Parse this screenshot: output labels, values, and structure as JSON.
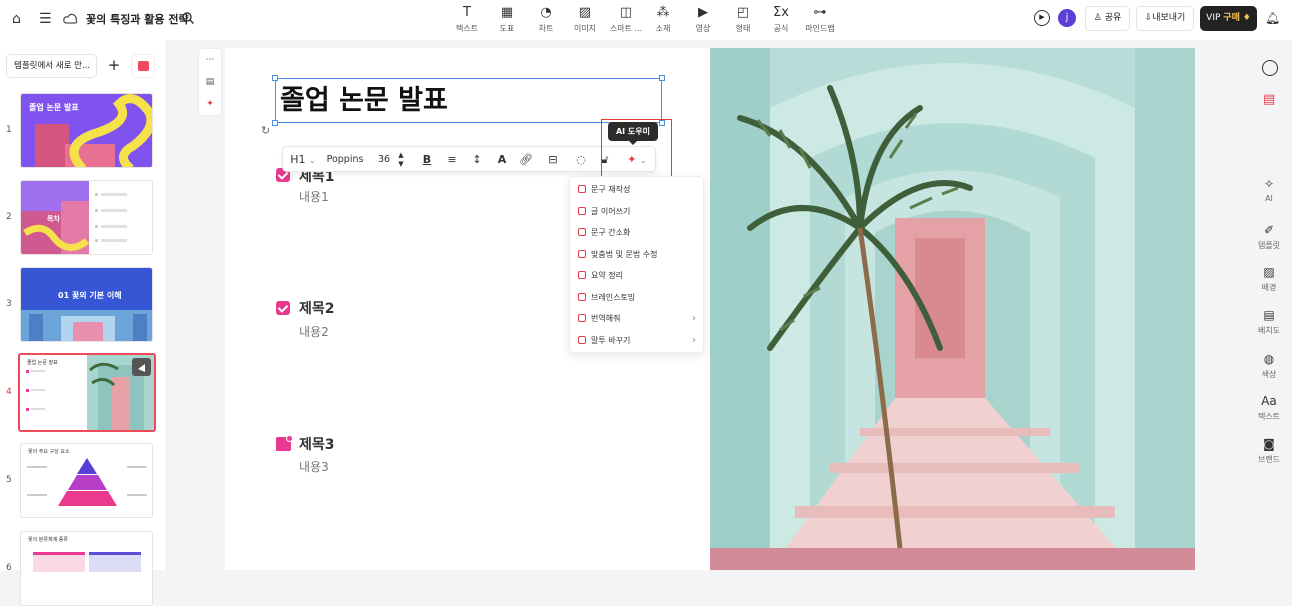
{
  "header": {
    "doc_title": "꽃의 특징과 활용 전략",
    "tools": [
      {
        "icon": "text-icon",
        "glyph": "T",
        "label": "텍스트"
      },
      {
        "icon": "table-icon",
        "glyph": "▦",
        "label": "도표"
      },
      {
        "icon": "chart-icon",
        "glyph": "◔",
        "label": "차트"
      },
      {
        "icon": "image-icon",
        "glyph": "▨",
        "label": "이미지"
      },
      {
        "icon": "smart-icon",
        "glyph": "◫",
        "label": "스마트 ..."
      },
      {
        "icon": "element-icon",
        "glyph": "⁂",
        "label": "소재"
      },
      {
        "icon": "video-icon",
        "glyph": "▶",
        "label": "영상"
      },
      {
        "icon": "shape-icon",
        "glyph": "◰",
        "label": "형태"
      },
      {
        "icon": "formula-icon",
        "glyph": "Σx",
        "label": "공식"
      },
      {
        "icon": "mindmap-icon",
        "glyph": "⊶",
        "label": "마인드맵"
      }
    ],
    "avatar_initial": "j",
    "share_label": "공유",
    "export_label": "내보내기",
    "vip_label": "VIP",
    "vip_buy": "구매"
  },
  "left_panel": {
    "template_button": "템플릿에서 새로 만...",
    "slides": [
      {
        "num": "1",
        "caption": "졸업 논문 발표"
      },
      {
        "num": "2",
        "caption": "목차"
      },
      {
        "num": "3",
        "caption": "01 꽃의 기본 이해"
      },
      {
        "num": "4",
        "caption": "졸업 논문 발표"
      },
      {
        "num": "5",
        "caption": "꽃의 주요 구성 요소"
      },
      {
        "num": "6",
        "caption": "꽃의 분류체계 종류"
      }
    ]
  },
  "slide": {
    "title": "졸업 논문 발표",
    "items": [
      {
        "title": "제목1",
        "body": "내용1"
      },
      {
        "title": "제목2",
        "body": "내용2"
      },
      {
        "title": "제목3",
        "body": "내용3"
      }
    ]
  },
  "format_toolbar": {
    "heading": "H1",
    "font": "Poppins",
    "size": "36"
  },
  "ai_tooltip": "AI 도우미",
  "ai_menu": [
    {
      "label": "문구 재작성",
      "submenu": false
    },
    {
      "label": "글 이어쓰기",
      "submenu": false
    },
    {
      "label": "문구 간소화",
      "submenu": false
    },
    {
      "label": "맞춤법 및 문법 수정",
      "submenu": false
    },
    {
      "label": "요약 정리",
      "submenu": false
    },
    {
      "label": "브레인스토밍",
      "submenu": false
    },
    {
      "label": "번역해줘",
      "submenu": true
    },
    {
      "label": "말투 바꾸기",
      "submenu": true
    }
  ],
  "right_bar": [
    {
      "icon": "ai-icon",
      "glyph": "✧",
      "label": "AI"
    },
    {
      "icon": "template-icon",
      "glyph": "✐",
      "label": "템플릿"
    },
    {
      "icon": "background-icon",
      "glyph": "▨",
      "label": "배경"
    },
    {
      "icon": "layout-icon",
      "glyph": "▤",
      "label": "배치도"
    },
    {
      "icon": "color-icon",
      "glyph": "◍",
      "label": "색상"
    },
    {
      "icon": "text-style-icon",
      "glyph": "Aa",
      "label": "텍스트"
    },
    {
      "icon": "brand-icon",
      "glyph": "◙",
      "label": "브랜드"
    }
  ],
  "colors": {
    "accent": "#e8388f",
    "selection": "#4a90e2",
    "highlight": "#e53935",
    "purple": "#7b4ff0"
  }
}
